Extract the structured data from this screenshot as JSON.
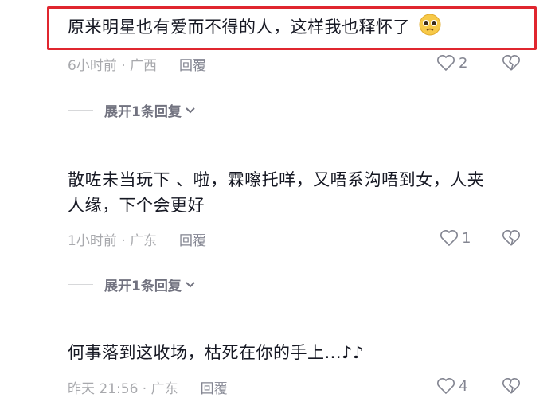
{
  "comments": [
    {
      "text": "原来明星也有爱而不得的人，这样我也释怀了",
      "emoji": "pleading-face-emoji",
      "time_location": "6小时前 · 广西",
      "reply_label": "回覆",
      "likes": "2",
      "expand_label": "展开1条回复",
      "highlighted": true
    },
    {
      "text_line1": "散咗未当玩下  、啦，霖嚓托咩，又唔系沟唔到女，人夹",
      "text_line2": "人缘，下个会更好",
      "time_location": "1小时前 · 广东",
      "reply_label": "回覆",
      "likes": "1",
      "expand_label": "展开1条回复"
    },
    {
      "text": "何事落到这收场，枯死在你的手上...♪♪",
      "time_location": "昨天 21:56 · 广东",
      "reply_label": "回覆",
      "likes": "4"
    }
  ],
  "colors": {
    "highlight": "#e0262f",
    "text": "#161823",
    "meta": "#a8a9ad"
  }
}
